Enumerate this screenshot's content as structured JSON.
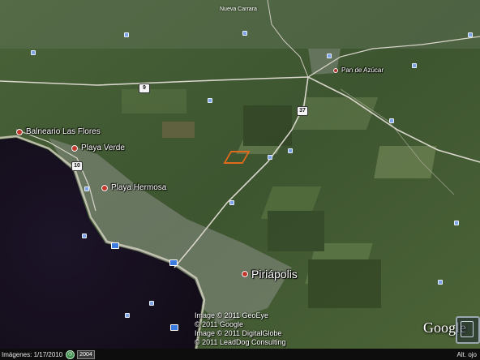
{
  "map": {
    "places": [
      {
        "name": "Balneario Las Flores",
        "size": "md"
      },
      {
        "name": "Playa Verde",
        "size": "md"
      },
      {
        "name": "Playa Hermosa",
        "size": "md"
      },
      {
        "name": "Piriápolis",
        "size": "lg"
      },
      {
        "name": "Pan de Azúcar",
        "size": "sm"
      },
      {
        "name": "Nueva Carrara",
        "size": "sm"
      }
    ],
    "route_shields": [
      "9",
      "37",
      "10"
    ],
    "imagery_credits": [
      "Image © 2011 GeoEye",
      "© 2011 Google",
      "Image © 2011 DigitalGlobe",
      "© 2011 LeadDog Consulting"
    ],
    "logo": "Google"
  },
  "status_bar": {
    "imagery_date": "Imágenes: 1/17/2010",
    "year": "2004",
    "altitude": "Alt. ojo"
  },
  "colors": {
    "ocean": "#16101e",
    "land": "#40592f",
    "road": "#d9d6cc",
    "town": "#8a8f86",
    "outline": "#e06a1c"
  }
}
